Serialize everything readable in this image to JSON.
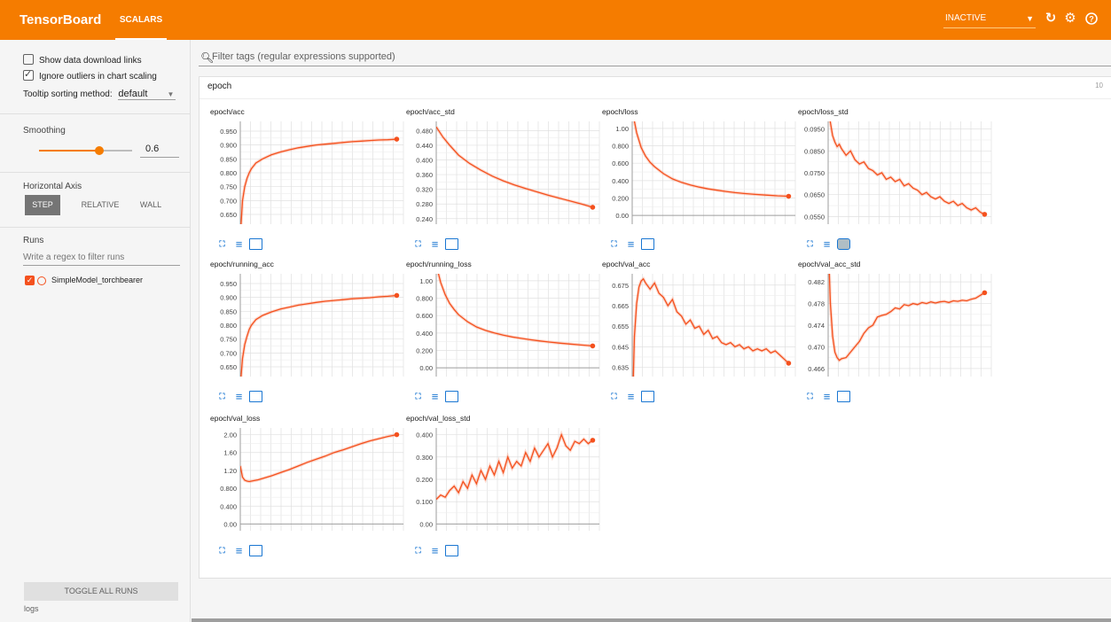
{
  "header": {
    "title": "TensorBoard",
    "tab": "SCALARS",
    "status_select": "INACTIVE",
    "icons": [
      "refresh-icon",
      "gear-icon",
      "help-icon"
    ]
  },
  "sidebar": {
    "show_download": "Show data download links",
    "ignore_outliers": "Ignore outliers in chart scaling",
    "tooltip_label": "Tooltip sorting method:",
    "tooltip_value": "default",
    "smoothing_title": "Smoothing",
    "smoothing_value": "0.6",
    "smoothing_fraction": 0.6,
    "haxis_title": "Horizontal Axis",
    "haxis_options": [
      "STEP",
      "RELATIVE",
      "WALL"
    ],
    "runs_title": "Runs",
    "runs_filter_placeholder": "Write a regex to filter runs",
    "runs": [
      "SimpleModel_torchbearer"
    ],
    "toggle_all": "TOGGLE ALL RUNS",
    "logs": "logs"
  },
  "main": {
    "filter_placeholder": "Filter tags (regular expressions supported)",
    "group_title": "epoch",
    "group_count": "10"
  },
  "colors": {
    "accent": "#f57c00",
    "series": "#f4511e",
    "link": "#1976d2"
  },
  "chart_data": [
    {
      "type": "line",
      "title": "epoch/acc",
      "yticks": [
        "0.950",
        "0.900",
        "0.850",
        "0.800",
        "0.750",
        "0.700",
        "0.650"
      ],
      "ylim": [
        0.615,
        0.985
      ],
      "x": [
        0,
        1,
        2,
        3,
        4,
        5,
        7,
        10,
        14,
        18,
        22,
        26,
        30,
        34,
        38,
        42,
        46,
        50,
        54,
        58,
        62,
        66,
        70
      ],
      "values": [
        0.57,
        0.7,
        0.75,
        0.78,
        0.8,
        0.815,
        0.835,
        0.85,
        0.865,
        0.875,
        0.883,
        0.89,
        0.895,
        0.9,
        0.903,
        0.906,
        0.909,
        0.912,
        0.914,
        0.916,
        0.918,
        0.919,
        0.921
      ]
    },
    {
      "type": "line",
      "title": "epoch/acc_std",
      "yticks": [
        "0.480",
        "0.440",
        "0.400",
        "0.360",
        "0.320",
        "0.280",
        "0.240"
      ],
      "ylim": [
        0.225,
        0.505
      ],
      "x": [
        0,
        3,
        6,
        10,
        15,
        20,
        25,
        30,
        35,
        40,
        45,
        50,
        55,
        60,
        65,
        70
      ],
      "values": [
        0.49,
        0.462,
        0.44,
        0.413,
        0.39,
        0.372,
        0.356,
        0.343,
        0.332,
        0.322,
        0.313,
        0.304,
        0.296,
        0.288,
        0.28,
        0.271
      ]
    },
    {
      "type": "line",
      "title": "epoch/loss",
      "yticks": [
        "1.00",
        "0.800",
        "0.600",
        "0.400",
        "0.200",
        "0.00"
      ],
      "ylim": [
        -0.1,
        1.08
      ],
      "x": [
        0,
        1,
        2,
        4,
        6,
        8,
        10,
        14,
        18,
        22,
        26,
        30,
        34,
        38,
        42,
        46,
        50,
        55,
        60,
        65,
        70
      ],
      "values": [
        1.5,
        1.08,
        0.95,
        0.78,
        0.68,
        0.61,
        0.56,
        0.48,
        0.42,
        0.38,
        0.35,
        0.325,
        0.305,
        0.29,
        0.275,
        0.262,
        0.252,
        0.242,
        0.234,
        0.226,
        0.22
      ]
    },
    {
      "type": "line",
      "title": "epoch/loss_std",
      "yticks": [
        "0.0950",
        "0.0850",
        "0.0750",
        "0.0650",
        "0.0550"
      ],
      "ylim": [
        0.0515,
        0.0985
      ],
      "x": [
        0,
        1,
        2,
        3,
        4,
        5,
        6,
        8,
        10,
        12,
        14,
        16,
        18,
        20,
        22,
        24,
        26,
        28,
        30,
        32,
        34,
        36,
        38,
        40,
        42,
        44,
        46,
        48,
        50,
        52,
        54,
        56,
        58,
        60,
        62,
        64,
        66,
        68,
        70
      ],
      "values": [
        0.105,
        0.098,
        0.092,
        0.089,
        0.087,
        0.088,
        0.086,
        0.083,
        0.085,
        0.081,
        0.079,
        0.08,
        0.077,
        0.076,
        0.074,
        0.075,
        0.072,
        0.073,
        0.071,
        0.072,
        0.069,
        0.07,
        0.068,
        0.067,
        0.065,
        0.066,
        0.064,
        0.063,
        0.064,
        0.062,
        0.061,
        0.062,
        0.06,
        0.061,
        0.059,
        0.058,
        0.059,
        0.057,
        0.056
      ]
    },
    {
      "type": "line",
      "title": "epoch/running_acc",
      "yticks": [
        "0.950",
        "0.900",
        "0.850",
        "0.800",
        "0.750",
        "0.700",
        "0.650"
      ],
      "ylim": [
        0.615,
        0.985
      ],
      "x": [
        0,
        1,
        2,
        3,
        4,
        5,
        7,
        10,
        14,
        18,
        22,
        26,
        30,
        34,
        38,
        42,
        46,
        50,
        54,
        58,
        62,
        66,
        70
      ],
      "values": [
        0.58,
        0.68,
        0.73,
        0.76,
        0.785,
        0.8,
        0.82,
        0.835,
        0.848,
        0.858,
        0.865,
        0.872,
        0.877,
        0.882,
        0.886,
        0.889,
        0.892,
        0.895,
        0.897,
        0.899,
        0.902,
        0.904,
        0.907
      ]
    },
    {
      "type": "line",
      "title": "epoch/running_loss",
      "yticks": [
        "1.00",
        "0.800",
        "0.600",
        "0.400",
        "0.200",
        "0.00"
      ],
      "ylim": [
        -0.1,
        1.08
      ],
      "x": [
        0,
        1,
        2,
        4,
        6,
        8,
        10,
        14,
        18,
        22,
        26,
        30,
        34,
        38,
        42,
        46,
        50,
        55,
        60,
        65,
        70
      ],
      "values": [
        1.3,
        1.08,
        0.98,
        0.84,
        0.74,
        0.67,
        0.61,
        0.53,
        0.47,
        0.43,
        0.4,
        0.375,
        0.355,
        0.338,
        0.323,
        0.31,
        0.298,
        0.285,
        0.273,
        0.262,
        0.252
      ]
    },
    {
      "type": "line",
      "title": "epoch/val_acc",
      "yticks": [
        "0.675",
        "0.665",
        "0.655",
        "0.645",
        "0.635"
      ],
      "ylim": [
        0.6305,
        0.6805
      ],
      "x": [
        0,
        1,
        2,
        3,
        4,
        5,
        6,
        8,
        10,
        12,
        14,
        16,
        18,
        20,
        22,
        24,
        26,
        28,
        30,
        32,
        34,
        36,
        38,
        40,
        42,
        44,
        46,
        48,
        50,
        52,
        54,
        56,
        58,
        60,
        62,
        64,
        66,
        68,
        70
      ],
      "values": [
        0.61,
        0.65,
        0.666,
        0.674,
        0.677,
        0.678,
        0.676,
        0.673,
        0.676,
        0.671,
        0.669,
        0.665,
        0.668,
        0.662,
        0.66,
        0.656,
        0.658,
        0.654,
        0.655,
        0.651,
        0.653,
        0.649,
        0.65,
        0.647,
        0.646,
        0.647,
        0.645,
        0.646,
        0.644,
        0.645,
        0.643,
        0.644,
        0.643,
        0.644,
        0.642,
        0.643,
        0.641,
        0.639,
        0.637
      ]
    },
    {
      "type": "line",
      "title": "epoch/val_acc_std",
      "yticks": [
        "0.482",
        "0.478",
        "0.474",
        "0.470",
        "0.466"
      ],
      "ylim": [
        0.4645,
        0.4835
      ],
      "x": [
        0,
        1,
        2,
        3,
        4,
        5,
        6,
        8,
        10,
        12,
        14,
        16,
        18,
        20,
        22,
        24,
        26,
        28,
        30,
        32,
        34,
        36,
        38,
        40,
        42,
        44,
        46,
        48,
        50,
        52,
        54,
        56,
        58,
        60,
        62,
        64,
        66,
        68,
        70
      ],
      "values": [
        0.49,
        0.478,
        0.472,
        0.469,
        0.468,
        0.4675,
        0.4678,
        0.468,
        0.469,
        0.47,
        0.471,
        0.4725,
        0.4735,
        0.474,
        0.4755,
        0.4758,
        0.476,
        0.4765,
        0.4772,
        0.477,
        0.4778,
        0.4776,
        0.478,
        0.4778,
        0.4782,
        0.478,
        0.4783,
        0.4781,
        0.4783,
        0.4784,
        0.4782,
        0.4785,
        0.4784,
        0.4786,
        0.4785,
        0.4788,
        0.479,
        0.4795,
        0.48
      ]
    },
    {
      "type": "line",
      "title": "epoch/val_loss",
      "yticks": [
        "2.00",
        "1.60",
        "1.20",
        "0.800",
        "0.400",
        "0.00"
      ],
      "ylim": [
        -0.15,
        2.15
      ],
      "x": [
        0,
        1,
        2,
        3,
        4,
        5,
        6,
        8,
        10,
        14,
        18,
        22,
        26,
        30,
        34,
        38,
        42,
        46,
        50,
        54,
        58,
        62,
        66,
        70
      ],
      "values": [
        1.3,
        1.05,
        0.98,
        0.96,
        0.95,
        0.96,
        0.97,
        0.99,
        1.02,
        1.08,
        1.15,
        1.22,
        1.3,
        1.38,
        1.45,
        1.52,
        1.6,
        1.66,
        1.73,
        1.8,
        1.86,
        1.91,
        1.96,
        2.0
      ]
    },
    {
      "type": "line",
      "title": "epoch/val_loss_std",
      "yticks": [
        "0.400",
        "0.300",
        "0.200",
        "0.100",
        "0.00"
      ],
      "ylim": [
        -0.03,
        0.43
      ],
      "x": [
        0,
        2,
        4,
        6,
        8,
        10,
        12,
        14,
        16,
        18,
        20,
        22,
        24,
        26,
        28,
        30,
        32,
        34,
        36,
        38,
        40,
        42,
        44,
        46,
        48,
        50,
        52,
        54,
        56,
        58,
        60,
        62,
        64,
        66,
        68,
        70
      ],
      "values": [
        0.11,
        0.13,
        0.12,
        0.15,
        0.17,
        0.14,
        0.19,
        0.16,
        0.22,
        0.18,
        0.24,
        0.2,
        0.26,
        0.22,
        0.28,
        0.23,
        0.3,
        0.25,
        0.28,
        0.26,
        0.32,
        0.28,
        0.34,
        0.3,
        0.33,
        0.36,
        0.3,
        0.34,
        0.4,
        0.35,
        0.33,
        0.37,
        0.36,
        0.38,
        0.36,
        0.375
      ]
    }
  ]
}
